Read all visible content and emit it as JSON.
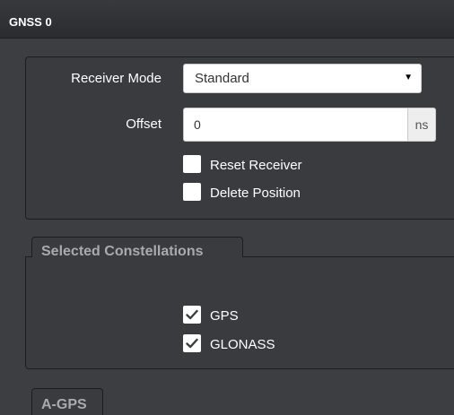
{
  "header": {
    "title": "GNSS 0"
  },
  "receiver": {
    "mode_label": "Receiver Mode",
    "mode_value": "Standard",
    "mode_arrow": "▼",
    "offset_label": "Offset",
    "offset_value": "0",
    "offset_unit": "ns",
    "options": [
      {
        "label": "Reset Receiver",
        "checked": false
      },
      {
        "label": "Delete Position",
        "checked": false
      }
    ]
  },
  "constellations": {
    "tab_label": "Selected Constellations",
    "items": [
      {
        "label": "GPS",
        "checked": true
      },
      {
        "label": "GLONASS",
        "checked": true
      }
    ]
  },
  "agps": {
    "tab_label": "A-GPS"
  },
  "colors": {
    "background": "#3d3e42",
    "header": "#2b2c30",
    "panel_border": "#1c1d20",
    "tab_text": "#a8aaad",
    "check_mark": "#3d3e42"
  }
}
